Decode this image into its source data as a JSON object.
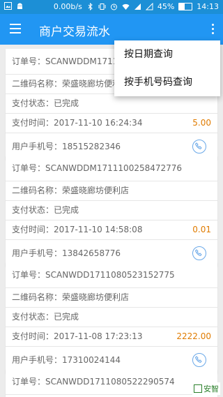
{
  "status_bar": {
    "speed": "0.00b/s",
    "battery": "45%",
    "time": "14:13"
  },
  "app_bar": {
    "title": "商户交易流水"
  },
  "dropdown": [
    {
      "label": "按日期查询"
    },
    {
      "label": "按手机号码查询"
    }
  ],
  "transactions": [
    {
      "order": "订单号：SCANWDDM17111",
      "store": "二维码名称：荣盛晓廊坊便利",
      "status": "支付状态：已完成",
      "time": "支付时间：2017-11-10 16:24:34",
      "amount": "5.00",
      "phone": "用户手机号：18515282346"
    },
    {
      "order": "订单号：SCANWDDM1711100258472776",
      "store": "二维码名称：荣盛晓廊坊便利店",
      "status": "支付状态：已完成",
      "time": "支付时间：2017-11-10 14:58:08",
      "amount": "0.01",
      "phone": "用户手机号：13842658776"
    },
    {
      "order": "订单号：SCANWDD1711080523152775",
      "store": "二维码名称：荣盛晓廊坊便利店",
      "status": "支付状态：已完成",
      "time": "支付时间：2017-11-08 17:23:13",
      "amount": "2222.00",
      "phone": "用户手机号：17310024144"
    },
    {
      "order": "订单号：SCANWDD1711080522290574"
    }
  ],
  "watermark": {
    "text": "安智"
  },
  "colors": {
    "app_bar": "#2196f3",
    "status_bar": "#1c8fd6",
    "amount": "#e07b00"
  }
}
